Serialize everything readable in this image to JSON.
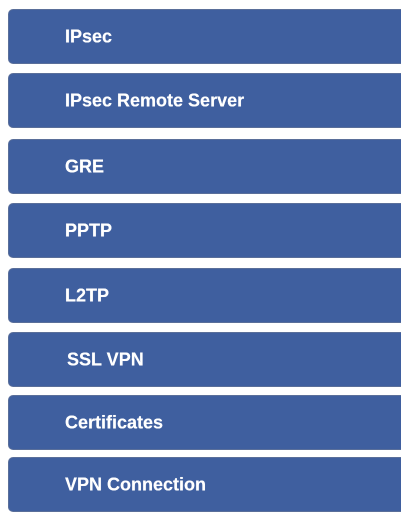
{
  "menu": {
    "items": [
      {
        "label": "IPsec"
      },
      {
        "label": "IPsec Remote Server"
      },
      {
        "label": "GRE"
      },
      {
        "label": "PPTP"
      },
      {
        "label": "L2TP"
      },
      {
        "label": "SSL VPN"
      },
      {
        "label": "Certificates"
      },
      {
        "label": "VPN Connection"
      }
    ]
  },
  "colors": {
    "item_background": "#3f5f9f",
    "item_text": "#ffffff"
  }
}
